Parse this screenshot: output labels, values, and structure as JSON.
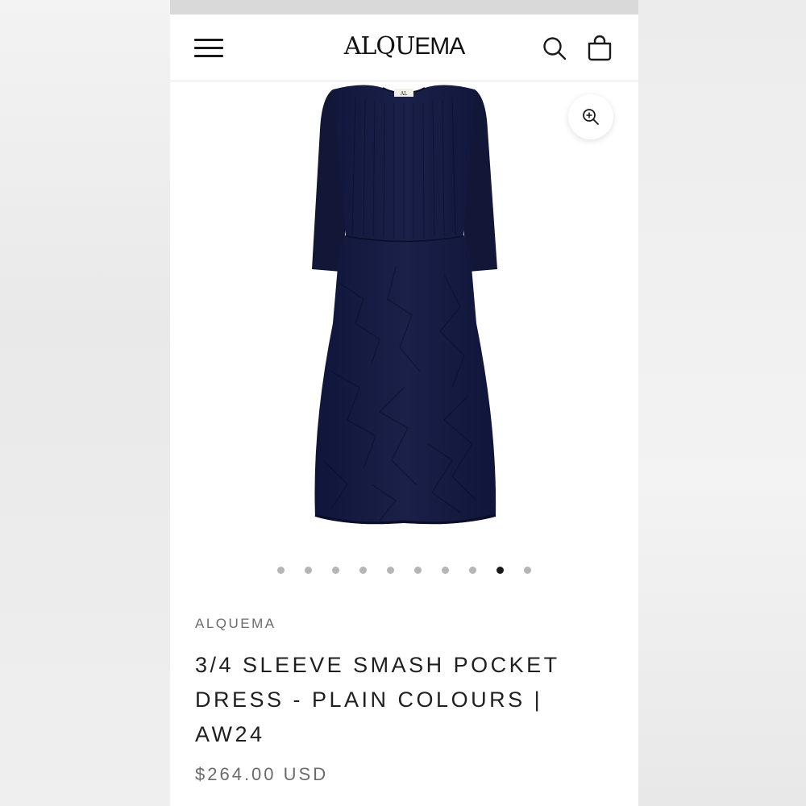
{
  "header": {
    "logo_a": "AL",
    "logo_b": "QU",
    "logo_c": "EMA"
  },
  "product": {
    "vendor": "ALQUEMA",
    "title": "3/4 SLEEVE SMASH POCKET DRESS - PLAIN COLOURS | AW24",
    "price": "$264.00 USD",
    "image_color": "#141a3a",
    "gallery": {
      "total_images": 10,
      "active_index": 9
    }
  },
  "icons": {
    "menu": "hamburger-menu-icon",
    "search": "search-icon",
    "cart": "shopping-bag-icon",
    "zoom": "zoom-in-icon"
  },
  "colors": {
    "accent": "#1a1a1a",
    "muted_text": "#6b6b6b",
    "dot_inactive": "#b5b5b5"
  }
}
